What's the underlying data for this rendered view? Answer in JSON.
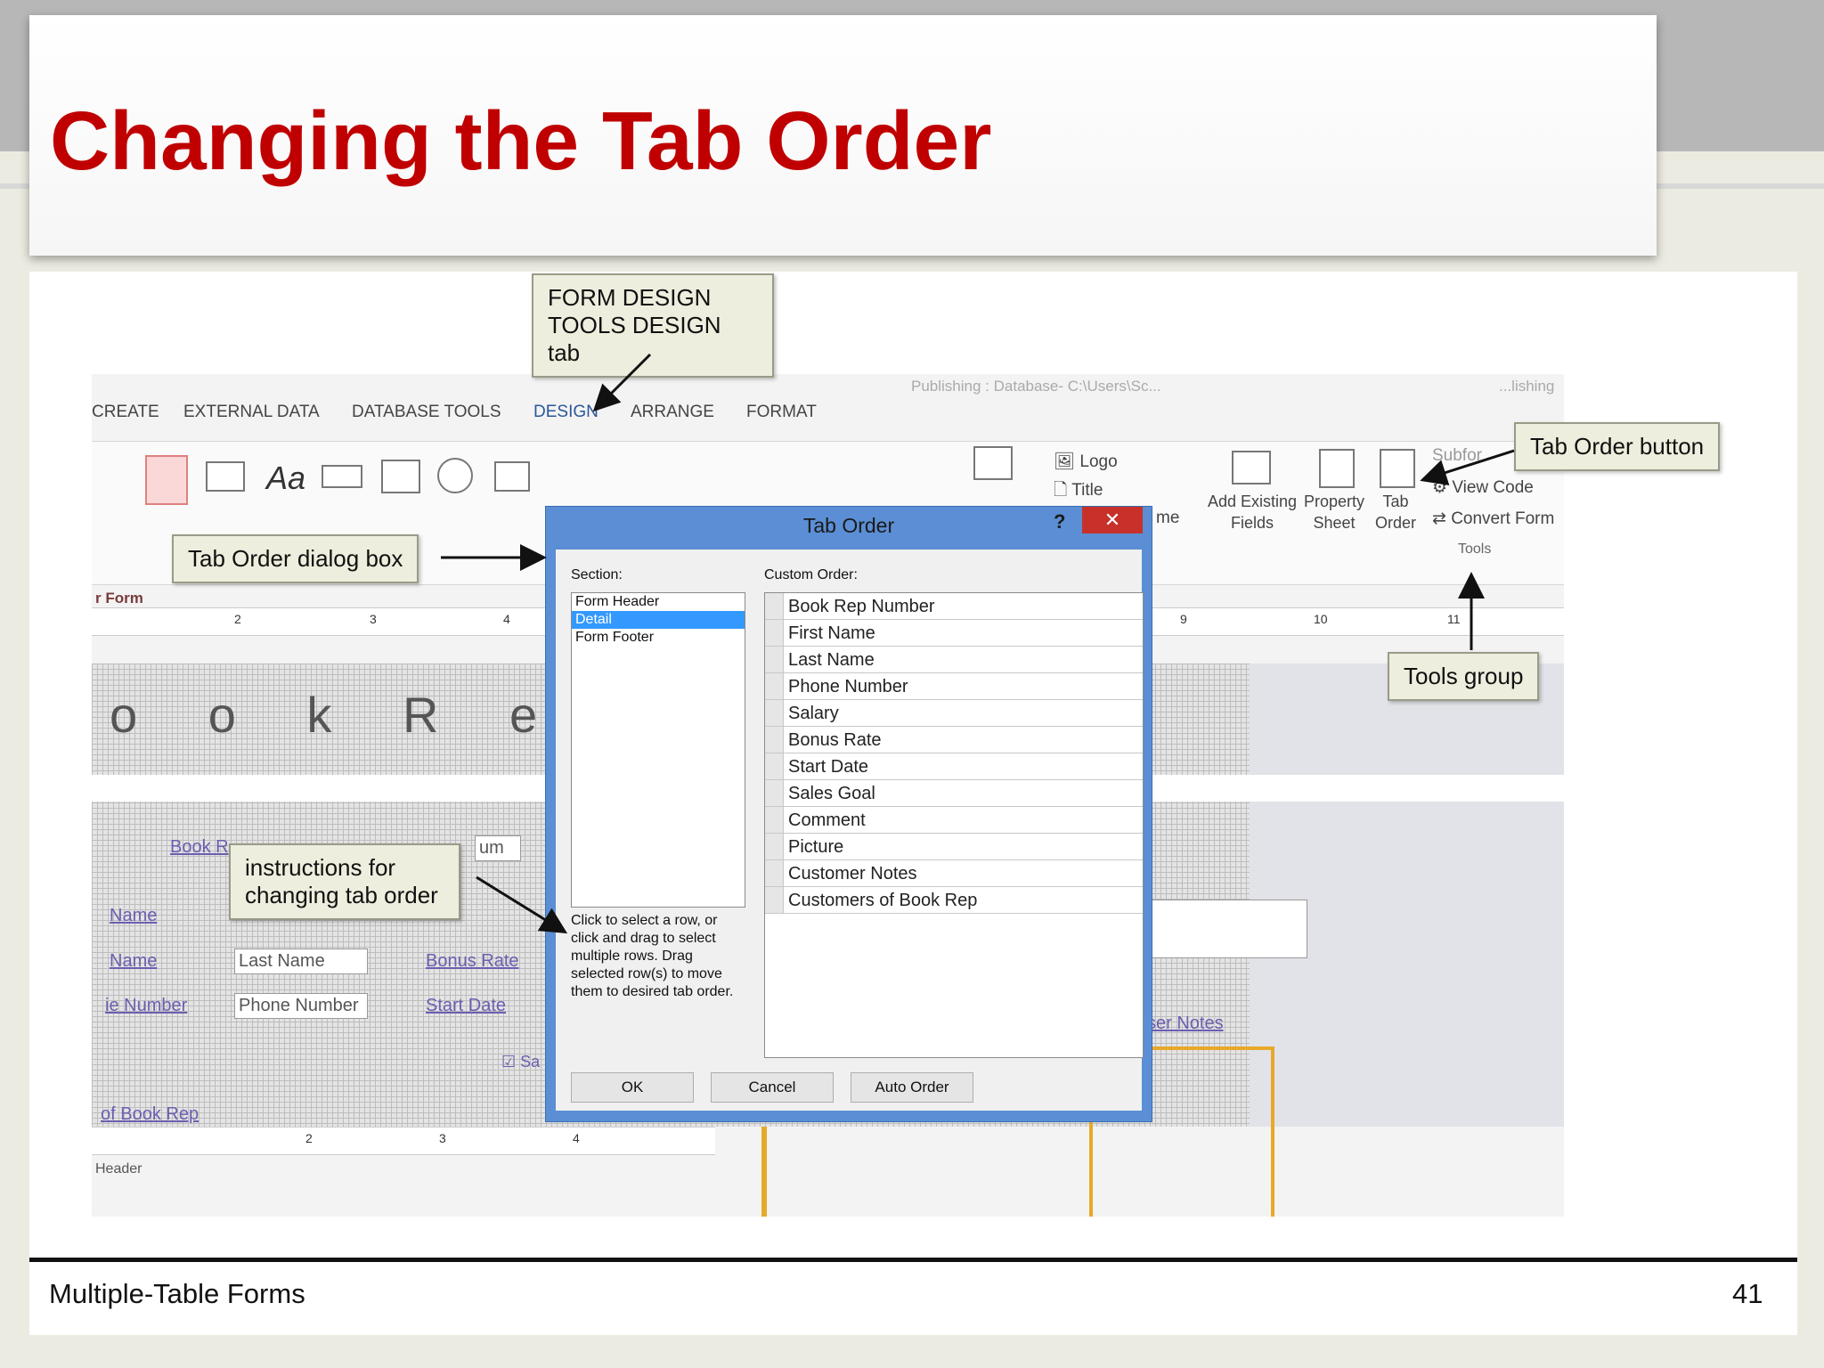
{
  "slide": {
    "title": "Changing the Tab Order",
    "footer_left": "Multiple-Table Forms",
    "page_number": "41"
  },
  "window": {
    "title_fragment": "Publishing : Database- C:\\Users\\Sc...",
    "title_fragment_right": "...lishing"
  },
  "ribbon": {
    "tabs": [
      "CREATE",
      "EXTERNAL DATA",
      "DATABASE TOOLS",
      "DESIGN",
      "ARRANGE",
      "FORMAT"
    ],
    "active_tab": "DESIGN",
    "header_footer": {
      "logo": "Logo",
      "title": "Title",
      "date_time_fragment": "me"
    },
    "tools": {
      "add_existing_fields": "Add Existing Fields",
      "property_sheet": "Property Sheet",
      "tab_order": "Tab Order",
      "subform_fragment": "Subfor",
      "view_code": "View Code",
      "convert_form": "Convert Form",
      "group_label": "Tools"
    },
    "object_tab": "r Form"
  },
  "form": {
    "heading_fragment": "o o k   R e p",
    "labels": [
      "Book R",
      "Name",
      "Name",
      "ie Number",
      "Bonus Rate",
      "Start Date",
      "of Book Rep",
      "ser Notes"
    ],
    "fields": [
      "Last Name",
      "Phone Number",
      "um"
    ],
    "checkbox_label": "Sa",
    "header_fragment": "Header"
  },
  "dialog": {
    "title": "Tab Order",
    "help": "?",
    "close": "✕",
    "section_label": "Section:",
    "sections": [
      "Form Header",
      "Detail",
      "Form Footer"
    ],
    "selected_section": "Detail",
    "custom_order_label": "Custom Order:",
    "custom_order": [
      "Book Rep Number",
      "First Name",
      "Last Name",
      "Phone Number",
      "Salary",
      "Bonus Rate",
      "Start Date",
      "Sales Goal",
      "Comment",
      "Picture",
      "Customer Notes",
      "Customers of Book Rep"
    ],
    "instructions": "Click to select a row, or click and drag to select multiple rows.  Drag selected row(s) to move them to desired tab order.",
    "buttons": {
      "ok": "OK",
      "cancel": "Cancel",
      "auto_order": "Auto Order"
    }
  },
  "callouts": {
    "design_tab": "FORM DESIGN TOOLS DESIGN tab",
    "tab_order_button": "Tab Order button",
    "tab_order_dialog": "Tab Order dialog box",
    "tools_group": "Tools group",
    "instructions": "instructions for changing tab order"
  }
}
